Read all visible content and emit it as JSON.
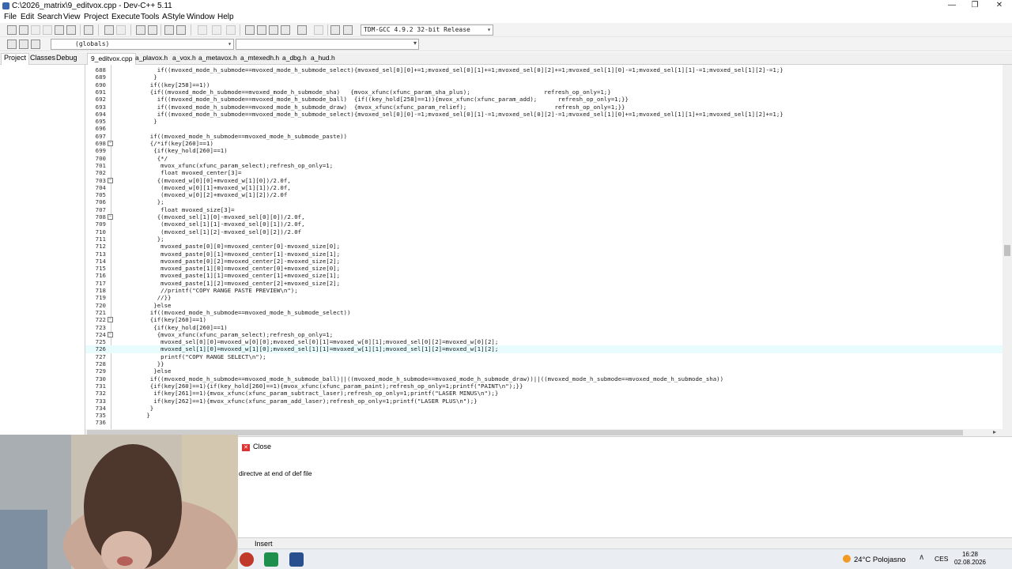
{
  "window": {
    "title": "C:\\2026_matrix\\9_editvox.cpp - Dev-C++ 5.11",
    "minimize": "—",
    "maximize": "❐",
    "close": "✕"
  },
  "menu": [
    "File",
    "Edit",
    "Search",
    "View",
    "Project",
    "Execute",
    "Tools",
    "AStyle",
    "Window",
    "Help"
  ],
  "toolbar": {
    "compiler": "TDM-GCC 4.9.2 32-bit Release",
    "globals": "(globals)"
  },
  "left_tabs": [
    "Project",
    "Classes",
    "Debug"
  ],
  "file_tabs": [
    "9_editvox.cpp",
    "a_plavox.h",
    "a_vox.h",
    "a_metavox.h",
    "a_mtexedh.h",
    "a_dbg.h",
    "a_hud.h"
  ],
  "editor": {
    "current_line": "726",
    "lines": [
      {
        "n": "688",
        "t": "      if((mvoxed_mode_h_submode==mvoxed_mode_h_submode_select){mvoxed_sel[0][0]+=1;mvoxed_sel[0][1]+=1;mvoxed_sel[0][2]+=1;mvoxed_sel[1][0]-=1;mvoxed_sel[1][1]-=1;mvoxed_sel[1][2]-=1;}"
      },
      {
        "n": "689",
        "t": "     }"
      },
      {
        "n": "690",
        "t": "    if((key[258]==1))"
      },
      {
        "n": "691",
        "t": "    {if((mvoxed_mode_h_submode==mvoxed_mode_h_submode_sha)   {mvox_xfunc(xfunc_param_sha_plus);                     refresh_op_only=1;}"
      },
      {
        "n": "692",
        "t": "      if((mvoxed_mode_h_submode==mvoxed_mode_h_submode_ball)  {if((key_hold[258]==1)){mvox_xfunc(xfunc_param_add);      refresh_op_only=1;}}"
      },
      {
        "n": "693",
        "t": "      if((mvoxed_mode_h_submode==mvoxed_mode_h_submode_draw)  {mvox_xfunc(xfunc_param_relief);                         refresh_op_only=1;}}"
      },
      {
        "n": "694",
        "t": "      if((mvoxed_mode_h_submode==mvoxed_mode_h_submode_select){mvoxed_sel[0][0]-=1;mvoxed_sel[0][1]-=1;mvoxed_sel[0][2]-=1;mvoxed_sel[1][0]+=1;mvoxed_sel[1][1]+=1;mvoxed_sel[1][2]+=1;}"
      },
      {
        "n": "695",
        "t": "     }"
      },
      {
        "n": "696",
        "t": ""
      },
      {
        "n": "697",
        "t": "    if((mvoxed_mode_h_submode==mvoxed_mode_h_submode_paste))"
      },
      {
        "n": "698",
        "t": "    {/*if(key[260]==1)"
      },
      {
        "n": "699",
        "t": "     {if(key_hold[260]==1)"
      },
      {
        "n": "700",
        "t": "      {*/"
      },
      {
        "n": "701",
        "t": "       mvox_xfunc(xfunc_param_select);refresh_op_only=1;"
      },
      {
        "n": "702",
        "t": "       float mvoxed_center[3]="
      },
      {
        "n": "703",
        "t": "      {(mvoxed_w[0][0]+mvoxed_w[1][0])/2.0f,"
      },
      {
        "n": "704",
        "t": "       (mvoxed_w[0][1]+mvoxed_w[1][1])/2.0f,"
      },
      {
        "n": "705",
        "t": "       (mvoxed_w[0][2]+mvoxed_w[1][2])/2.0f"
      },
      {
        "n": "706",
        "t": "      };"
      },
      {
        "n": "707",
        "t": "       float mvoxed_size[3]="
      },
      {
        "n": "708",
        "t": "      {(mvoxed_sel[1][0]-mvoxed_sel[0][0])/2.0f,"
      },
      {
        "n": "709",
        "t": "       (mvoxed_sel[1][1]-mvoxed_sel[0][1])/2.0f,"
      },
      {
        "n": "710",
        "t": "       (mvoxed_sel[1][2]-mvoxed_sel[0][2])/2.0f"
      },
      {
        "n": "711",
        "t": "      };"
      },
      {
        "n": "712",
        "t": "       mvoxed_paste[0][0]=mvoxed_center[0]-mvoxed_size[0];"
      },
      {
        "n": "713",
        "t": "       mvoxed_paste[0][1]=mvoxed_center[1]-mvoxed_size[1];"
      },
      {
        "n": "714",
        "t": "       mvoxed_paste[0][2]=mvoxed_center[2]-mvoxed_size[2];"
      },
      {
        "n": "715",
        "t": "       mvoxed_paste[1][0]=mvoxed_center[0]+mvoxed_size[0];"
      },
      {
        "n": "716",
        "t": "       mvoxed_paste[1][1]=mvoxed_center[1]+mvoxed_size[1];"
      },
      {
        "n": "717",
        "t": "       mvoxed_paste[1][2]=mvoxed_center[2]+mvoxed_size[2];"
      },
      {
        "n": "718",
        "t": "       //printf(\"COPY RANGE PASTE PREVIEW\\n\");"
      },
      {
        "n": "719",
        "t": "      //}}"
      },
      {
        "n": "720",
        "t": "     }else"
      },
      {
        "n": "721",
        "t": "    if((mvoxed_mode_h_submode==mvoxed_mode_h_submode_select))"
      },
      {
        "n": "722",
        "t": "    {if(key[260]==1)"
      },
      {
        "n": "723",
        "t": "     {if(key_hold[260]==1)"
      },
      {
        "n": "724",
        "t": "      {mvox_xfunc(xfunc_param_select);refresh_op_only=1;"
      },
      {
        "n": "725",
        "t": "       mvoxed_sel[0][0]=mvoxed_w[0][0];mvoxed_sel[0][1]=mvoxed_w[0][1];mvoxed_sel[0][2]=mvoxed_w[0][2];"
      },
      {
        "n": "726",
        "t": "       mvoxed_sel[1][0]=mvoxed_w[1][0];mvoxed_sel[1][1]=mvoxed_w[1][1];mvoxed_sel[1][2]=mvoxed_w[1][2];"
      },
      {
        "n": "727",
        "t": "       printf(\"COPY RANGE SELECT\\n\");"
      },
      {
        "n": "728",
        "t": "      }}"
      },
      {
        "n": "729",
        "t": "     }else"
      },
      {
        "n": "730",
        "t": "    if((mvoxed_mode_h_submode==mvoxed_mode_h_submode_ball)||((mvoxed_mode_h_submode==mvoxed_mode_h_submode_draw))||((mvoxed_mode_h_submode==mvoxed_mode_h_submode_sha))"
      },
      {
        "n": "731",
        "t": "    {if(key[260]==1){if(key_hold[260]==1){mvox_xfunc(xfunc_param_paint);refresh_op_only=1;printf(\"PAINT\\n\");}}"
      },
      {
        "n": "732",
        "t": "     if(key[261]==1){mvox_xfunc(xfunc_param_subtract_laser);refresh_op_only=1;printf(\"LASER MINUS\\n\");}"
      },
      {
        "n": "733",
        "t": "     if(key[262]==1){mvox_xfunc(xfunc_param_add_laser);refresh_op_only=1;printf(\"LASER PLUS\\n\");}"
      },
      {
        "n": "734",
        "t": "    }"
      },
      {
        "n": "735",
        "t": "   }"
      },
      {
        "n": "736",
        "t": ""
      }
    ],
    "fold_lines": [
      "698",
      "703",
      "708",
      "722",
      "724"
    ]
  },
  "bottom": {
    "close_label": "Close",
    "message": "directve at end of def file"
  },
  "status": {
    "insert": "Insert"
  },
  "taskbar": {
    "weather": "24°C  Polojasno",
    "chevron": "∧",
    "lang": "CES",
    "time": "16:28",
    "date": "02.08.2026"
  },
  "colors": {
    "current_line_bg": "#e8fbfd",
    "accent": "#3a66b0"
  }
}
